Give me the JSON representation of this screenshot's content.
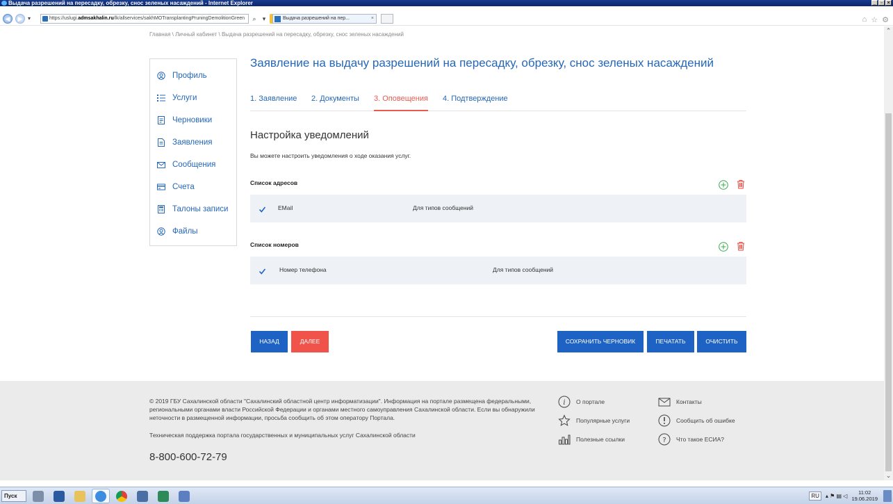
{
  "browser": {
    "title": "Выдача разрешений на пересадку, обрезку, снос зеленых насаждений - Internet Explorer",
    "url_prefix": "https://uslugi.",
    "url_domain": "admsakhalin.ru",
    "url_path": "/lk/allservices/sakhMOTransplantingPruningDemolitionGreen",
    "tab_label": "Выдача разрешений на пер...",
    "tab_close": "×",
    "back": "◀",
    "forward": "▶",
    "win_min": "_",
    "win_max": "▫",
    "win_close": "×",
    "home_icon": "⌂",
    "fav_icon": "☆",
    "settings_icon": "⚙",
    "search_glyph": "⌕",
    "dropdown_glyph": "▾",
    "refresh_glyph": "↻"
  },
  "breadcrumb": "Главная  \\  Личный кабинет  \\  Выдача разрешений на пересадку, обрезку, снос зеленых насаждений",
  "sidebar": {
    "items": [
      {
        "label": "Профиль",
        "icon": "profile-icon"
      },
      {
        "label": "Услуги",
        "icon": "services-icon"
      },
      {
        "label": "Черновики",
        "icon": "drafts-icon"
      },
      {
        "label": "Заявления",
        "icon": "applications-icon"
      },
      {
        "label": "Сообщения",
        "icon": "messages-icon"
      },
      {
        "label": "Счета",
        "icon": "bills-icon"
      },
      {
        "label": "Талоны записи",
        "icon": "tickets-icon"
      },
      {
        "label": "Файлы",
        "icon": "files-icon"
      }
    ]
  },
  "main": {
    "title": "Заявление на выдачу разрешений на пересадку, обрезку, снос зеленых насаждений",
    "steps": [
      {
        "label": "1. Заявление",
        "active": false
      },
      {
        "label": "2. Документы",
        "active": false
      },
      {
        "label": "3. Оповещения",
        "active": true
      },
      {
        "label": "4. Подтверждение",
        "active": false
      }
    ],
    "section_title": "Настройка уведомлений",
    "section_desc": "Вы можете настроить уведомления о ходе оказания услуг.",
    "addresses": {
      "title": "Список адресов",
      "row": {
        "checked": true,
        "col1": "EMail",
        "col2": "Для типов сообщений"
      }
    },
    "numbers": {
      "title": "Список номеров",
      "row": {
        "checked": true,
        "col1": "Номер телефона",
        "col2": "Для типов сообщений"
      }
    },
    "buttons": {
      "back": "Назад",
      "next": "Далее",
      "save_draft": "Сохранить черновик",
      "print": "Печатать",
      "clear": "Очистить"
    }
  },
  "footer": {
    "copyright": "© 2019 ГБУ Сахалинской области \"Сахалинский областной центр информатизации\". Информация на портале размещена федеральными, региональными органами власти Российской Федерации и органами местного самоуправления Сахалинской области. Если вы обнаружили неточности в размещенной информации, просьба сообщить об этом оператору Портала.",
    "support": "Техническая поддержка портала государственных и муниципальных услуг Сахалинской области",
    "phone": "8-800-600-72-79",
    "links": {
      "about": "О портале",
      "contacts": "Контакты",
      "popular": "Популярные услуги",
      "report_error": "Сообщить об ошибке",
      "useful_links": "Полезные ссылки",
      "esia": "Что такое ЕСИА?"
    }
  },
  "taskbar": {
    "start": "Пуск",
    "lang": "RU",
    "time": "11:02",
    "date": "19.06.2019"
  },
  "colors": {
    "accent_blue": "#2567b8",
    "button_blue": "#1e63c4",
    "button_red": "#f0534a",
    "active_step": "#e85a4f",
    "add_green": "#3aa84a",
    "delete_red": "#e8443a"
  }
}
